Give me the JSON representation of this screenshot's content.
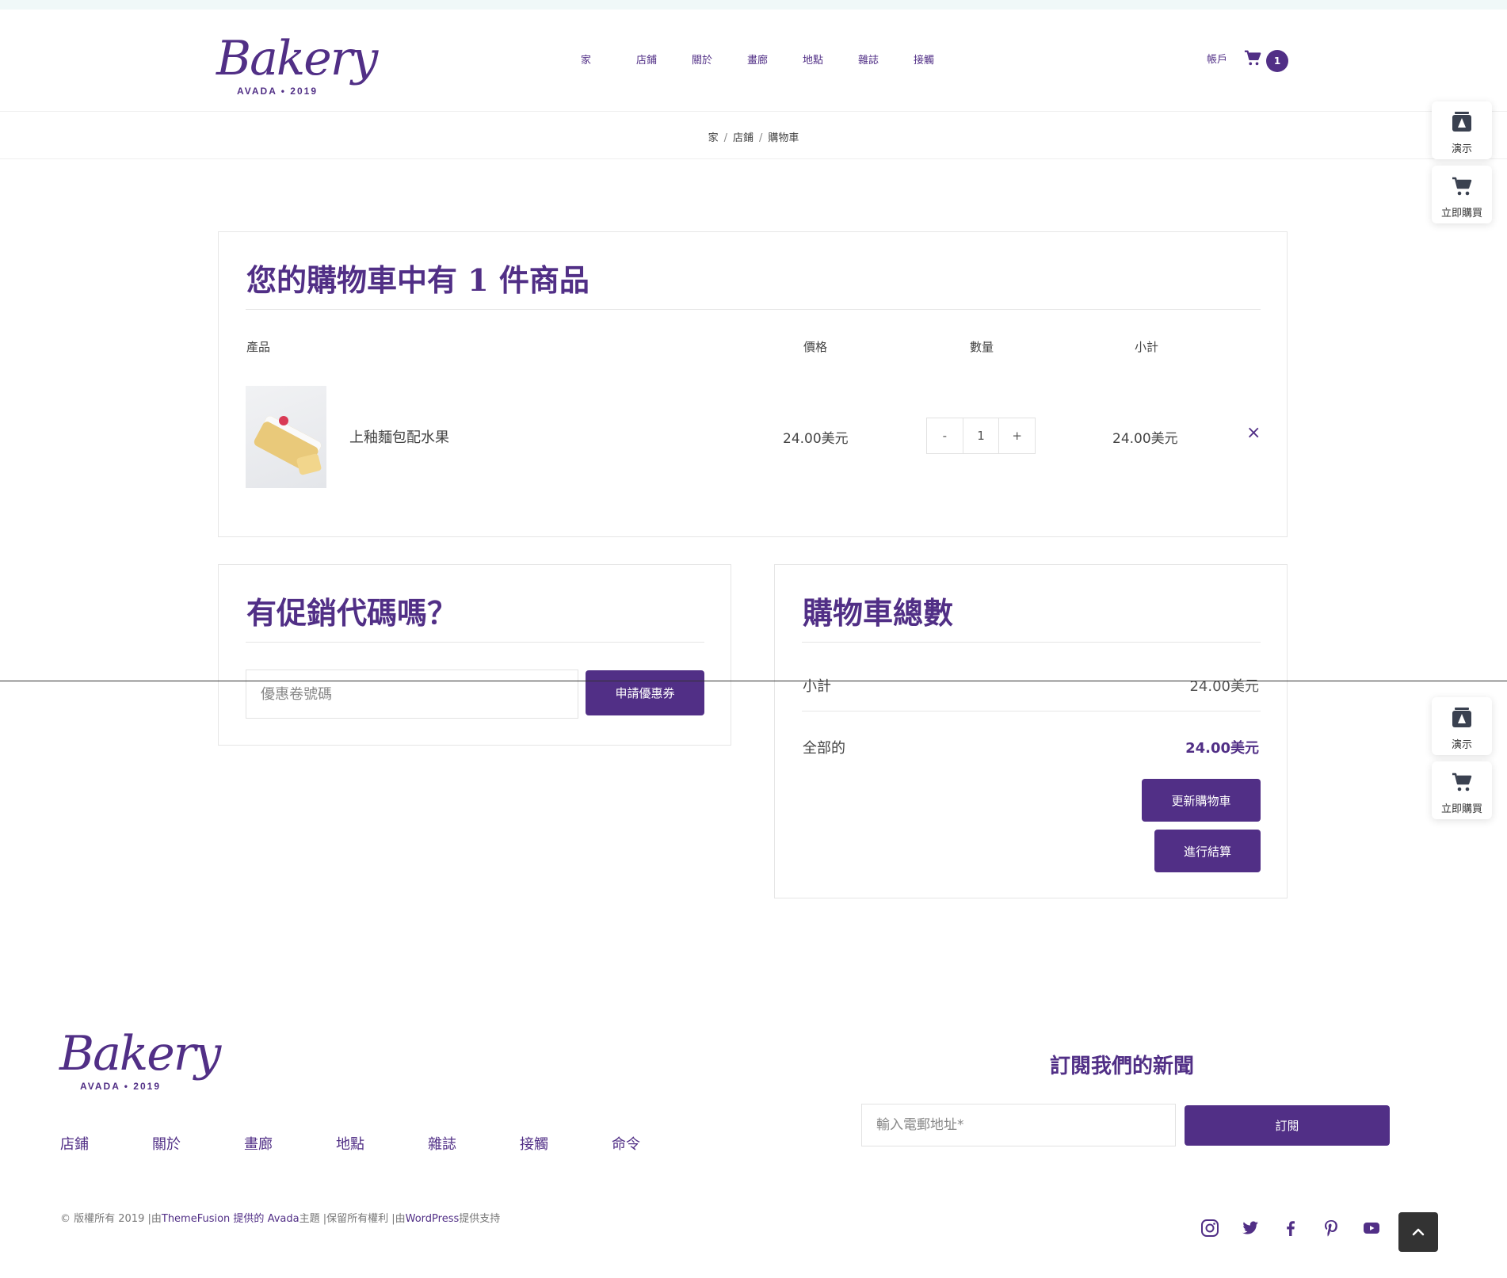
{
  "brand": {
    "logo_text": "Bakery",
    "tagline": "AVADA • 2019",
    "color": "#512f86"
  },
  "nav": {
    "items": [
      "家",
      "店鋪",
      "關於",
      "畫廊",
      "地點",
      "雜誌",
      "接觸"
    ],
    "account": "帳戶",
    "cart_count": "1"
  },
  "breadcrumb": {
    "items": [
      "家",
      "店鋪",
      "購物車"
    ],
    "separator": "/"
  },
  "cart": {
    "title": "您的購物車中有 1 件商品",
    "headers": {
      "product": "產品",
      "price": "價格",
      "quantity": "數量",
      "subtotal": "小計"
    },
    "item": {
      "name": "上釉麵包配水果",
      "price": "24.00美元",
      "qty_minus": "-",
      "qty_value": "1",
      "qty_plus": "+",
      "subtotal": "24.00美元",
      "remove": "×"
    }
  },
  "coupon": {
    "title": "有促銷代碼嗎？",
    "placeholder": "優惠卷號碼",
    "button": "申請優惠券"
  },
  "totals": {
    "title": "購物車總數",
    "subtotal_label": "小計",
    "subtotal_value": "24.00美元",
    "total_label": "全部的",
    "total_value": "24.00美元",
    "update_button": "更新購物車",
    "checkout_button": "進行結算"
  },
  "side_widgets": {
    "demo": "演示",
    "buy": "立即購買"
  },
  "footer": {
    "nav": [
      "店鋪",
      "關於",
      "畫廊",
      "地點",
      "雜誌",
      "接觸",
      "命令"
    ],
    "newsletter_title": "訂閱我們的新聞",
    "email_placeholder": "輸入電郵地址*",
    "subscribe_button": "訂閱",
    "copyright_prefix": "© 版權所有 2019 |由",
    "copyright_link1": "ThemeFusion 提供的 Avada",
    "copyright_mid": "主題 |保留所有權利 |由",
    "copyright_link2": "WordPress",
    "copyright_suffix": "提供支持",
    "social": [
      "instagram-icon",
      "twitter-icon",
      "facebook-icon",
      "pinterest-icon",
      "youtube-icon"
    ]
  }
}
